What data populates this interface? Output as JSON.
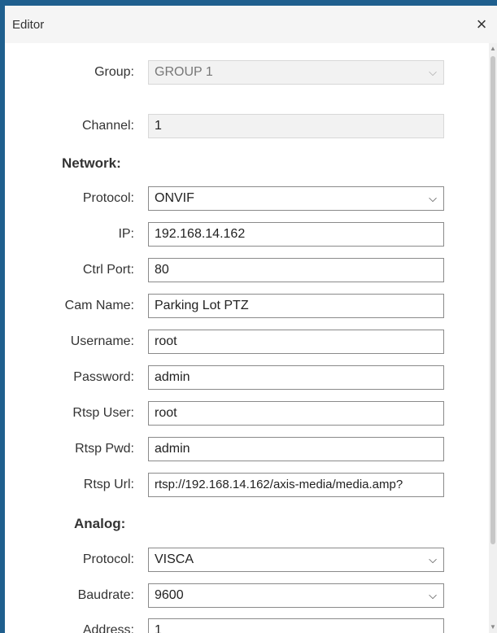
{
  "window": {
    "title": "Editor",
    "close_label": "×"
  },
  "form": {
    "group": {
      "label": "Group:",
      "value": "GROUP 1"
    },
    "channel": {
      "label": "Channel:",
      "value": "1"
    },
    "network": {
      "heading": "Network:",
      "protocol": {
        "label": "Protocol:",
        "value": "ONVIF"
      },
      "ip": {
        "label": "IP:",
        "value": "192.168.14.162"
      },
      "ctrl_port": {
        "label": "Ctrl Port:",
        "value": "80"
      },
      "cam_name": {
        "label": "Cam Name:",
        "value": "Parking Lot PTZ"
      },
      "username": {
        "label": "Username:",
        "value": "root"
      },
      "password": {
        "label": "Password:",
        "value": "admin"
      },
      "rtsp_user": {
        "label": "Rtsp User:",
        "value": "root"
      },
      "rtsp_pwd": {
        "label": "Rtsp Pwd:",
        "value": "admin"
      },
      "rtsp_url": {
        "label": "Rtsp Url:",
        "value": "rtsp://192.168.14.162/axis-media/media.amp?"
      }
    },
    "analog": {
      "heading": "Analog:",
      "protocol": {
        "label": "Protocol:",
        "value": "VISCA"
      },
      "baudrate": {
        "label": "Baudrate:",
        "value": "9600"
      },
      "address": {
        "label": "Address:",
        "value": "1"
      }
    }
  },
  "icons": {
    "close": "close-icon",
    "dropdown": "chevron-down-icon"
  }
}
